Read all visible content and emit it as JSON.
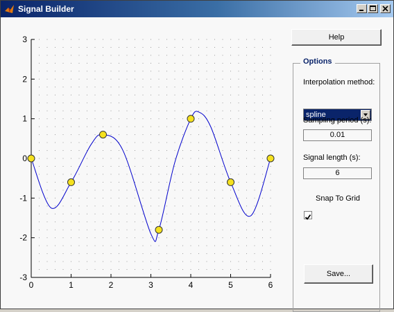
{
  "window": {
    "title": "Signal Builder"
  },
  "controls": {
    "help_label": "Help",
    "options_title": "Options",
    "interp_label": "Interpolation method:",
    "interp_value": "spline",
    "sampling_label": "Sampling period (s):",
    "sampling_value": "0.01",
    "length_label": "Signal length (s):",
    "length_value": "6",
    "snap_label": "Snap To Grid",
    "snap_checked": true,
    "save_label": "Save..."
  },
  "chart_data": {
    "type": "line",
    "title": "",
    "xlabel": "",
    "ylabel": "",
    "xlim": [
      0,
      6
    ],
    "ylim": [
      -3,
      3
    ],
    "xticks": [
      "0",
      "1",
      "2",
      "3",
      "4",
      "5",
      "6"
    ],
    "yticks": [
      "3",
      "2",
      "1",
      "0",
      "-1",
      "-2",
      "-3"
    ],
    "grid": "dotted",
    "series": [
      {
        "color": "#0000cc",
        "x": [
          0,
          0.5,
          1,
          1.5,
          1.8,
          2.3,
          3,
          3.2,
          3.6,
          4,
          4.2,
          4.5,
          5,
          5.5,
          6
        ],
        "y": [
          0,
          -1.25,
          -0.6,
          0.35,
          0.6,
          0.2,
          -1.9,
          -1.8,
          -0.1,
          1.0,
          1.17,
          0.8,
          -0.6,
          -1.45,
          0
        ]
      }
    ],
    "control_points": {
      "color": "#f5e11e",
      "x": [
        0,
        1,
        1.8,
        3.2,
        4,
        5,
        6
      ],
      "y": [
        0,
        -0.6,
        0.6,
        -1.8,
        1.0,
        -0.6,
        0
      ]
    }
  }
}
